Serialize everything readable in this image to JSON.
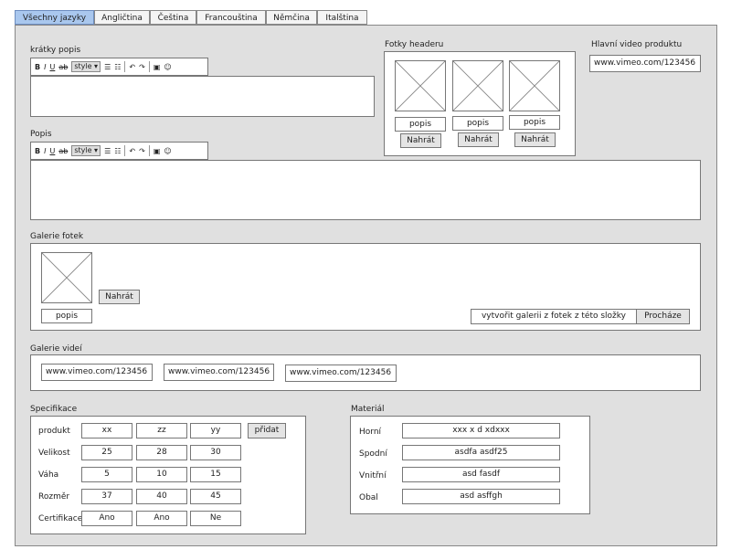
{
  "tabs": [
    "Všechny jazyky",
    "Angličtina",
    "Čeština",
    "Francouština",
    "Němčina",
    "Italština"
  ],
  "short_desc": {
    "label": "krátky popis"
  },
  "desc": {
    "label": "Popis"
  },
  "toolbar": {
    "bold": "B",
    "italic": "I",
    "underline": "U",
    "strike": "ab",
    "style": "style",
    "style_arrow": "▾"
  },
  "header_photos": {
    "label": "Fotky headeru",
    "caption": "popis",
    "upload": "Nahrát"
  },
  "main_video": {
    "label": "Hlavní video produktu",
    "value": "www.vimeo.com/123456"
  },
  "gallery": {
    "label": "Galerie fotek",
    "caption": "popis",
    "upload": "Nahrát",
    "folder_input": "vytvořit galerii z fotek z této složky",
    "browse": "Procháze"
  },
  "video_gallery": {
    "label": "Galerie videí",
    "videos": [
      "www.vimeo.com/123456",
      "www.vimeo.com/123456",
      "www.vimeo.com/123456"
    ]
  },
  "spec": {
    "label": "Specifikace",
    "add": "přidat",
    "rows": [
      {
        "name": "produkt",
        "values": [
          "xx",
          "zz",
          "yy"
        ]
      },
      {
        "name": "Velikost",
        "values": [
          "25",
          "28",
          "30"
        ]
      },
      {
        "name": "Váha",
        "values": [
          "5",
          "10",
          "15"
        ]
      },
      {
        "name": "Rozměr",
        "values": [
          "37",
          "40",
          "45"
        ]
      },
      {
        "name": "Certifikace",
        "values": [
          "Ano",
          "Ano",
          "Ne"
        ]
      }
    ]
  },
  "material": {
    "label": "Materiál",
    "rows": [
      {
        "name": "Horní",
        "value": "xxx x d xdxxx"
      },
      {
        "name": "Spodní",
        "value": "asdfa asdf25"
      },
      {
        "name": "Vnitřní",
        "value": "asd fasdf"
      },
      {
        "name": "Obal",
        "value": "asd asffgh"
      }
    ]
  }
}
